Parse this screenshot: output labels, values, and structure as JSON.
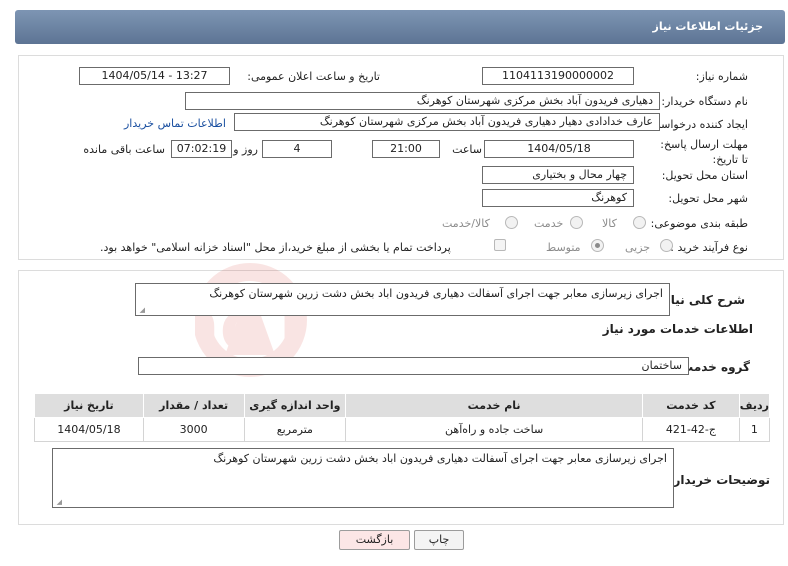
{
  "header": {
    "title": "جزئیات اطلاعات نیاز"
  },
  "fields": {
    "need_number_label": "شماره نیاز:",
    "need_number": "1104113190000002",
    "announce_label": "تاریخ و ساعت اعلان عمومی:",
    "announce_value": "1404/05/14 - 13:27",
    "buyer_org_label": "نام دستگاه خریدار:",
    "buyer_org": "دهیاری فریدون آباد بخش مرکزی شهرستان کوهرنگ",
    "creator_label": "ایجاد کننده درخواست:",
    "creator": "عارف خدادادی دهیار دهیاری فریدون آباد بخش مرکزی شهرستان کوهرنگ",
    "contact_link": "اطلاعات تماس خریدار",
    "deadline_label": "مهلت ارسال پاسخ: تا تاریخ:",
    "deadline_date": "1404/05/18",
    "time_label": "ساعت",
    "deadline_time": "21:00",
    "days_value": "4",
    "days_label": "روز و",
    "remaining_time": "07:02:19",
    "remaining_label": "ساعت باقی مانده",
    "province_label": "استان محل تحویل:",
    "province": "چهار محال و بختیاری",
    "city_label": "شهر محل تحویل:",
    "city": "کوهرنگ",
    "category_label": "طبقه بندی موضوعی:",
    "category_options": [
      "کالا",
      "خدمت",
      "کالا/خدمت"
    ],
    "process_label": "نوع فرآیند خرید :",
    "process_options": [
      "جزیی",
      "متوسط"
    ],
    "payment_note": "پرداخت تمام یا بخشی از مبلغ خرید،از محل \"اسناد خزانه اسلامی\" خواهد بود."
  },
  "summary": {
    "label": "شرح کلی نیاز:",
    "text": "اجرای زیرسازی معابر جهت اجرای آسفالت دهیاری فریدون اباد بخش دشت زرین شهرستان کوهرنگ"
  },
  "services": {
    "title": "اطلاعات خدمات مورد نیاز",
    "group_label": "گروه خدمت:",
    "group_value": "ساختمان",
    "columns": [
      "ردیف",
      "کد خدمت",
      "نام خدمت",
      "واحد اندازه گیری",
      "تعداد / مقدار",
      "تاریخ نیاز"
    ],
    "rows": [
      [
        "1",
        "ج-42-421",
        "ساخت جاده و راه‌آهن",
        "مترمربع",
        "3000",
        "1404/05/18"
      ]
    ]
  },
  "buyer_notes": {
    "label": "توضیحات خریدار:",
    "text": "اجرای زیرسازی معابر جهت اجرای آسفالت دهیاری فریدون اباد بخش دشت زرین شهرستان کوهرنگ"
  },
  "buttons": {
    "print": "چاپ",
    "back": "بازگشت"
  },
  "watermark": {
    "text": "AriaTender.neT"
  },
  "colors": {
    "header": "#6a82a2",
    "link": "#1a4fa0",
    "back_button": "#fce6e6",
    "watermark": "#d63a2f"
  }
}
